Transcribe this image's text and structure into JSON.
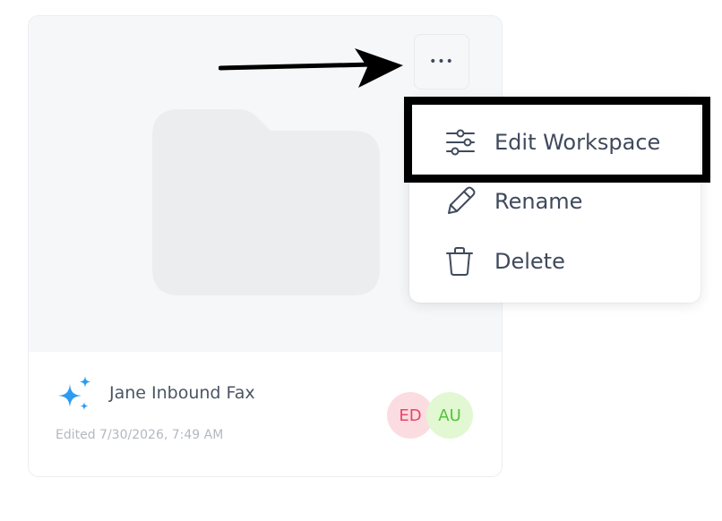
{
  "workspace_card": {
    "name": "Jane Inbound Fax",
    "edited": "Edited 7/30/2026, 7:49 AM",
    "more_button_glyph": "•••",
    "members": [
      {
        "initials": "ED",
        "bg": "#fbdde1",
        "fg": "#e7456b"
      },
      {
        "initials": "AU",
        "bg": "#e1f8d2",
        "fg": "#57c23d"
      }
    ],
    "folder_color": "#ecedef",
    "sparkle_color": "#2b9cf2"
  },
  "context_menu": {
    "items": [
      {
        "label": "Edit Workspace",
        "icon": "sliders-icon"
      },
      {
        "label": "Rename",
        "icon": "pencil-icon"
      },
      {
        "label": "Delete",
        "icon": "trash-icon"
      }
    ],
    "highlighted_item": "Edit Workspace"
  },
  "annotations": {
    "arrow_color": "#000000",
    "highlight_color": "#000000"
  }
}
